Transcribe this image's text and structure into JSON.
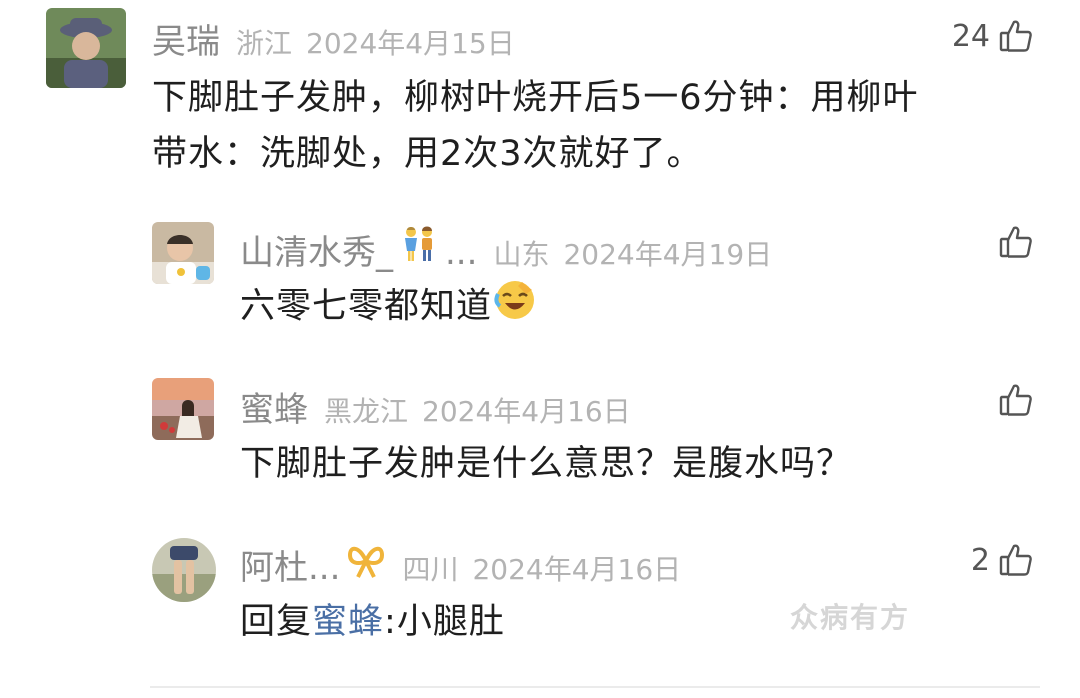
{
  "comments": [
    {
      "username": "吴瑞",
      "location": "浙江",
      "date": "2024年4月15日",
      "likes": "24",
      "text_line1": "下脚肚子发肿，柳树叶烧开后5一6分钟：用柳叶",
      "text_line2": "带水：洗脚处，用2次3次就好了。"
    },
    {
      "username": "山清水秀_",
      "username_suffix": "...",
      "username_emoji": "couple-emoji",
      "location": "山东",
      "date": "2024年4月19日",
      "likes": "",
      "text": "六零七零都知道",
      "text_emoji": "laughing-crying-emoji"
    },
    {
      "username": "蜜蜂",
      "location": "黑龙江",
      "date": "2024年4月16日",
      "likes": "",
      "text": "下脚肚子发肿是什么意思？是腹水吗？"
    },
    {
      "username": "阿杜...",
      "username_emoji": "ribbon-emoji",
      "location": "四川",
      "date": "2024年4月16日",
      "likes": "2",
      "reply_prefix": "回复",
      "reply_to": "蜜蜂",
      "reply_text": ":小腿肚"
    }
  ],
  "watermark": "众病有方",
  "colors": {
    "username": "#8a8a8a",
    "meta": "#b3b3b3",
    "body": "#1f1f1f",
    "reply_link": "#4a6fa5"
  }
}
